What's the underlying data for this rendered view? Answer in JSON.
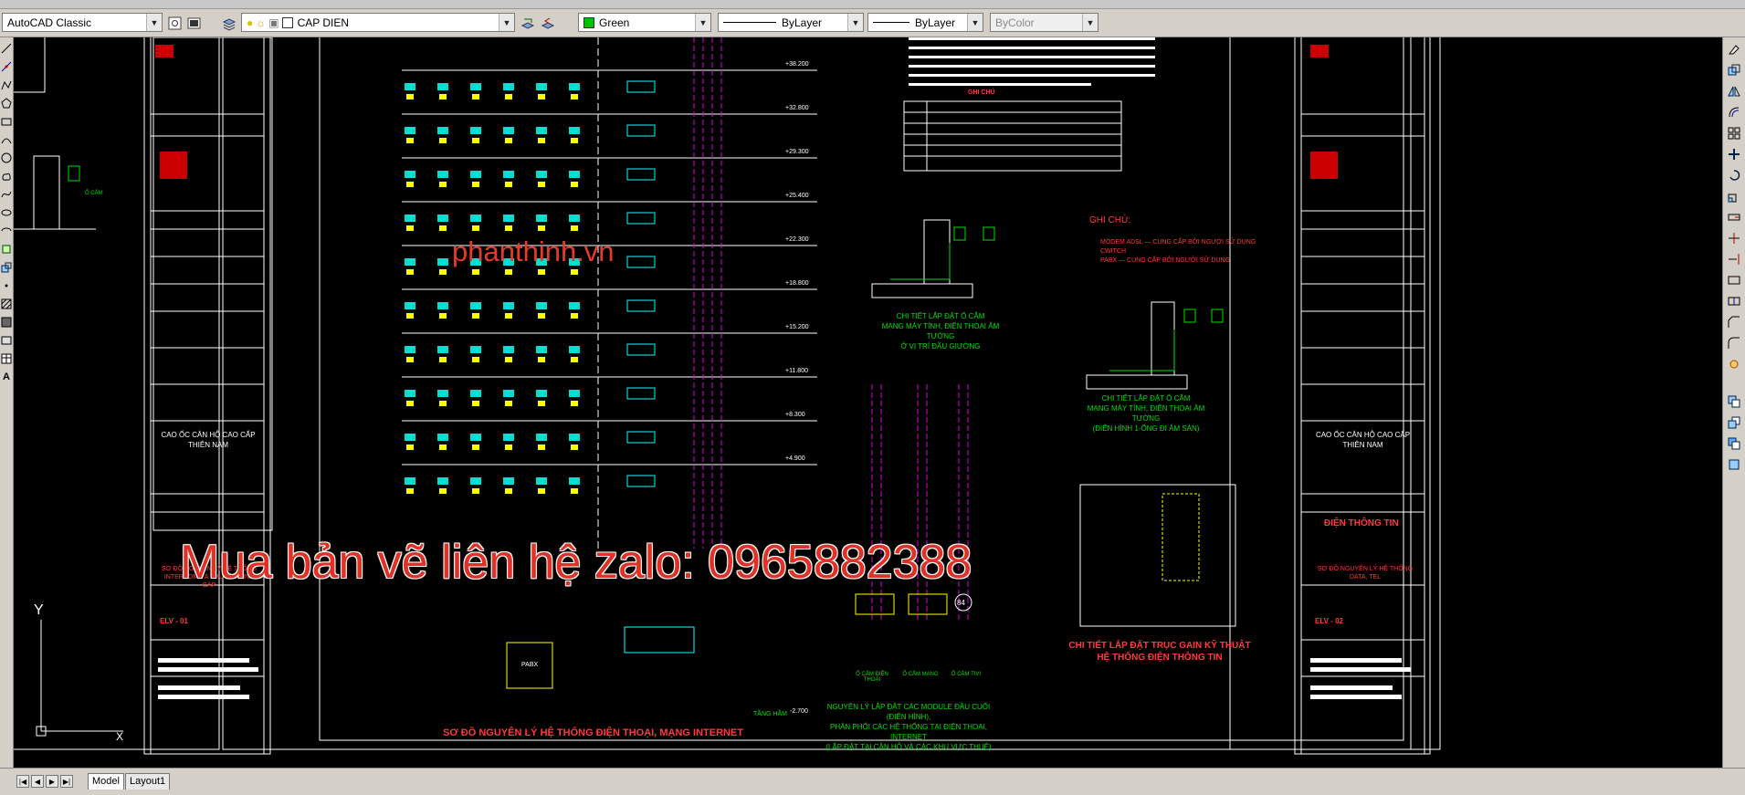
{
  "toolbar": {
    "workspace": "AutoCAD Classic",
    "layer": "CAP DIEN",
    "color": "Green",
    "linetype": "ByLayer",
    "lineweight": "ByLayer",
    "plotstyle": "ByColor",
    "color_hex": "#00c000"
  },
  "tabs": {
    "model": "Model",
    "layout1": "Layout1"
  },
  "watermarks": {
    "site": "phanthinh.vn",
    "contact": "Mua bản vẽ liên hệ zalo: 0965882388"
  },
  "drawing": {
    "main_title": "SƠ ĐỒ NGUYÊN LÝ HỆ THỐNG ĐIỆN THOẠI, MẠNG INTERNET",
    "section_title": "GHI CHÚ:",
    "legend_title": "GHI CHÚ",
    "detail1_title": "CHI TIẾT LẮP ĐẶT Ổ CẮM",
    "detail1_sub1": "MẠNG MÁY TÍNH, ĐIỆN THOẠI ÂM TƯỜNG",
    "detail1_sub2": "Ở VỊ TRÍ ĐẦU GIƯỜNG",
    "detail2_title": "CHI TIẾT LẮP ĐẶT Ổ CẮM",
    "detail2_sub1": "MẠNG MÁY TÍNH, ĐIỆN THOẠI ÂM TƯỜNG",
    "detail2_sub2": "(ĐIỂN HÌNH 1-ỐNG ĐI ÂM SÀN)",
    "module_title1": "NGUYÊN LÝ LẮP ĐẶT CÁC MODULE ĐẦU CUỐI (ĐIỂN HÌNH),",
    "module_title2": "PHÂN PHỐI CÁC HỆ THỐNG TẠI ĐIỆN THOẠI, INTERNET",
    "module_title3": "(LẮP ĐẶT TẠI CĂN HỘ VÀ CÁC KHU VỰC THUÊ)",
    "shaft_title1": "CHI TIẾT LẮP ĐẶT TRỤC GAIN KỸ THUẬT",
    "shaft_title2": "HỆ THỐNG ĐIỆN THÔNG TIN",
    "note_modem": "MODEM ADSL",
    "note_switch": "CWITCH",
    "note_pabx": "PABX",
    "note_user1": "CUNG CẤP BỞI NGƯỜI SỬ DỤNG",
    "note_user2": "CUNG CẤP BỞI NGƯỜI SỬ DỤNG",
    "project1": "CAO ỐC CĂN HỘ CAO CẤP",
    "project2": "THIÊN NAM",
    "sheet_left_title": "SƠ ĐỒ NGUYÊN LÝ HỆ THỐNG INTERCOM VÀ TRUYỀN HÌNH CÁP",
    "sheet_right_title": "SƠ ĐỒ NGUYÊN LÝ HỆ THỐNG DATA, TEL",
    "dept": "ĐIỆN THÔNG TIN",
    "code_left": "ELV - 01",
    "code_right": "ELV - 02",
    "tang_ham": "TẦNG HẦM",
    "elev_bottom": "-2.700",
    "label_a": "Ổ CẮM",
    "label_tel": "Ổ CẮM ĐIỆN THOẠI",
    "label_tv": "Ổ CẮM TIVI",
    "label_mang": "Ổ CẮM MẠNG",
    "label_pabx": "PABX",
    "floor_levels": [
      "+38.200",
      "+32.800",
      "+29.300",
      "+25.400",
      "+22.300",
      "+18.800",
      "+15.200",
      "+11.800",
      "+8.300",
      "+4.900"
    ]
  }
}
